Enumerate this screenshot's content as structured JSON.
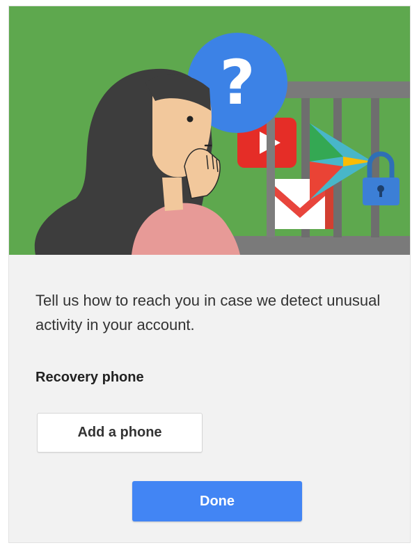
{
  "hero": {
    "background_color": "#5ea84e",
    "question_mark": "?",
    "icons": [
      "woman-illustration-icon",
      "question-bubble-icon",
      "youtube-icon",
      "gmail-icon",
      "play-store-icon",
      "cage-bars-icon",
      "padlock-icon"
    ]
  },
  "content": {
    "message": "Tell us how to reach you in case we detect unusual activity in your account.",
    "recovery_label": "Recovery phone",
    "add_phone_label": "Add a phone",
    "done_label": "Done"
  },
  "colors": {
    "accent": "#4285f4",
    "hero_green": "#5ea84e",
    "card_bg": "#f2f2f2"
  }
}
